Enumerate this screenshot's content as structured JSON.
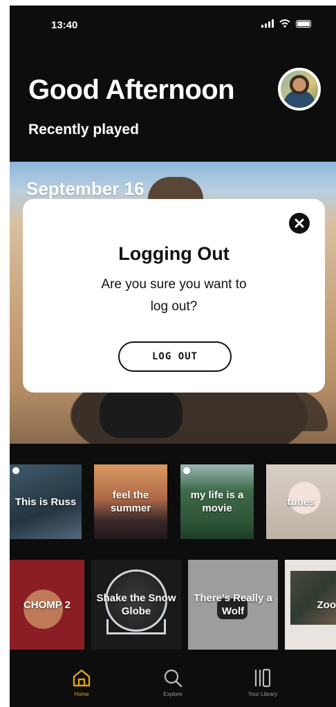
{
  "status_bar": {
    "time": "13:40"
  },
  "header": {
    "greeting": "Good Afternoon",
    "subheading": "Recently played"
  },
  "hero": {
    "date": "September 16"
  },
  "modal": {
    "title": "Logging Out",
    "message_line1": "Are you sure you want to",
    "message_line2": "log out?",
    "button_label": "LOG OUT",
    "close_icon": "close-icon"
  },
  "row1": [
    {
      "label": "This is Russ"
    },
    {
      "label": "feel the summer"
    },
    {
      "label": "my life is a movie"
    },
    {
      "label": "tunes"
    }
  ],
  "row2": [
    {
      "label": "CHOMP 2"
    },
    {
      "label": "Shake the Snow Globe"
    },
    {
      "label": "There's Really a Wolf"
    },
    {
      "label": "Zoo"
    }
  ],
  "nav": {
    "home": "Home",
    "explore": "Explore",
    "library": "Your Library"
  },
  "colors": {
    "accent": "#e3a21a",
    "background": "#0d0d0d"
  }
}
